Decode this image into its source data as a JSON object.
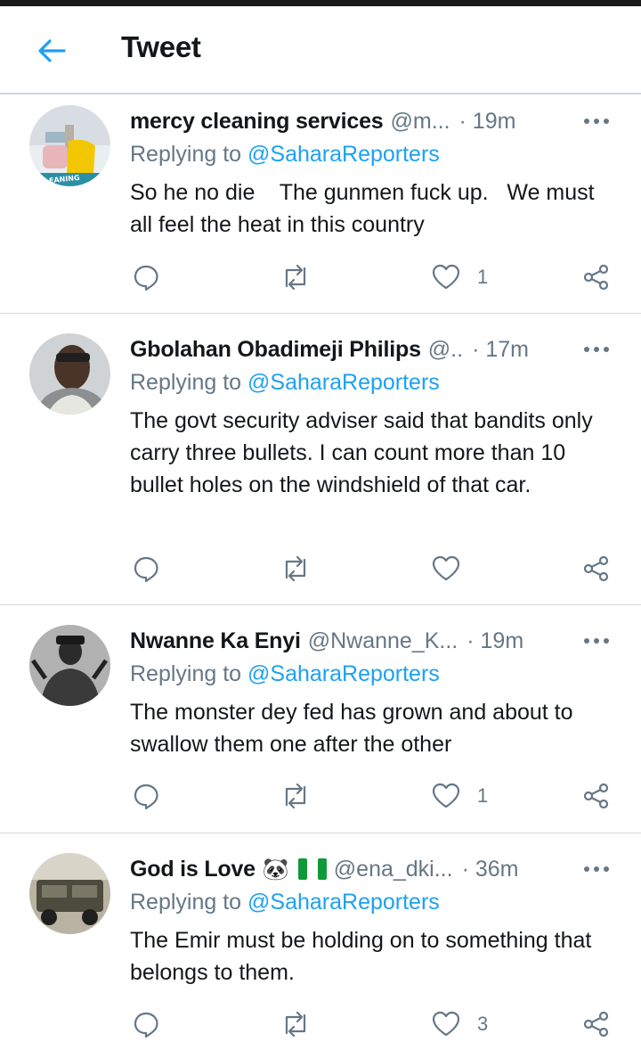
{
  "header": {
    "title": "Tweet"
  },
  "replying_label": "Replying to ",
  "tweets": [
    {
      "name": "mercy cleaning services",
      "handle": "@m...",
      "time": "· 19m",
      "mention": "@SaharaReporters",
      "text": "So he no die    The gunmen fuck up.   We must all feel the heat in this country",
      "likes": "1",
      "avatar_text": "E CLEANING"
    },
    {
      "name": "Gbolahan Obadimeji Philips",
      "handle": "@..",
      "time": "· 17m",
      "mention": "@SaharaReporters",
      "text": "The govt security adviser said that bandits only carry three bullets. I can count more than 10 bullet holes on the windshield of that car.",
      "likes": ""
    },
    {
      "name": "Nwanne Ka Enyi",
      "handle": "@Nwanne_K...",
      "time": "· 19m",
      "mention": "@SaharaReporters",
      "text": "The monster dey fed has grown and about to swallow them one after the other",
      "likes": "1"
    },
    {
      "name": "God is Love",
      "emoji": "🐼",
      "handle": "@ena_dki...",
      "time": "· 36m",
      "mention": "@SaharaReporters",
      "text": "The Emir must be holding on to something that belongs to them.",
      "likes": "3"
    }
  ]
}
